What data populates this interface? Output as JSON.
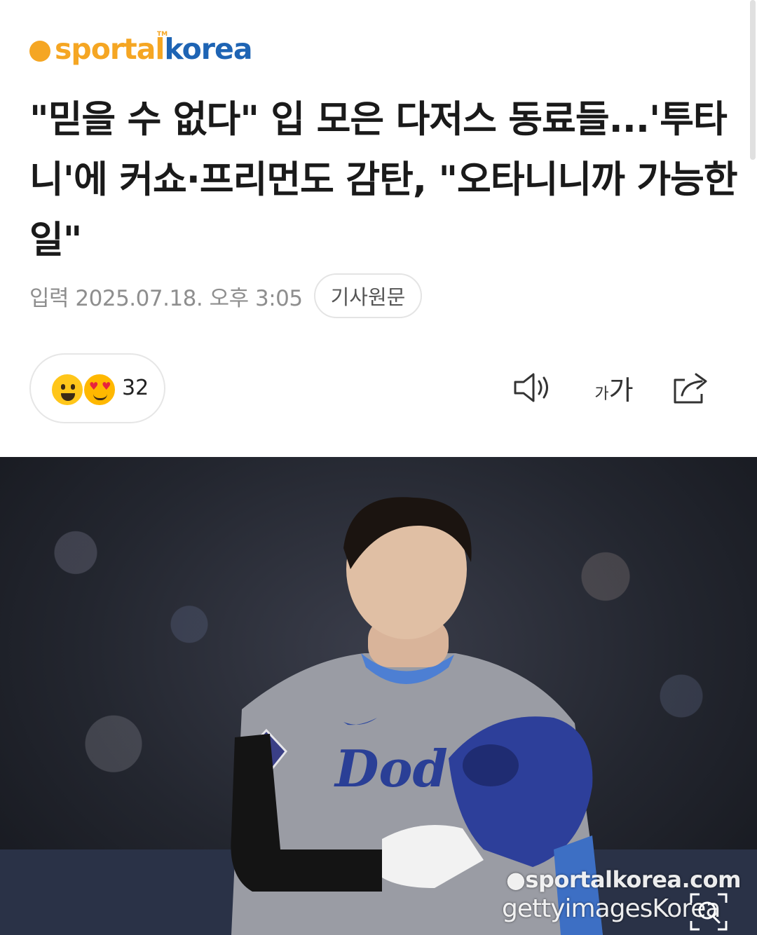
{
  "header": {
    "logo_primary": "sportal",
    "logo_secondary": "korea",
    "logo_tm": "TM"
  },
  "article": {
    "headline": "\"믿을 수 없다\" 입 모은 다저스 동료들...'투타니'에 커쇼·프리먼도 감탄, \"오타니니까 가능한 일\"",
    "date": "입력 2025.07.18. 오후 3:05",
    "original_button": "기사원문"
  },
  "reactions": {
    "count": "32",
    "emoji_1": "grinning-face",
    "emoji_2": "heart-eyes-face"
  },
  "toolbar": {
    "speaker_icon": "speaker-icon",
    "fontsize_small": "가",
    "fontsize_big": "가",
    "share_icon": "share-icon"
  },
  "photo": {
    "watermark_line1": "●sportalkorea.com",
    "watermark_line2": "gettyimagesKorea",
    "zoom_icon": "zoom-icon"
  },
  "colors": {
    "logo_orange": "#f5a623",
    "logo_blue": "#1e64b4",
    "headline": "#1a1a1a",
    "meta_gray": "#8e8e8e"
  }
}
